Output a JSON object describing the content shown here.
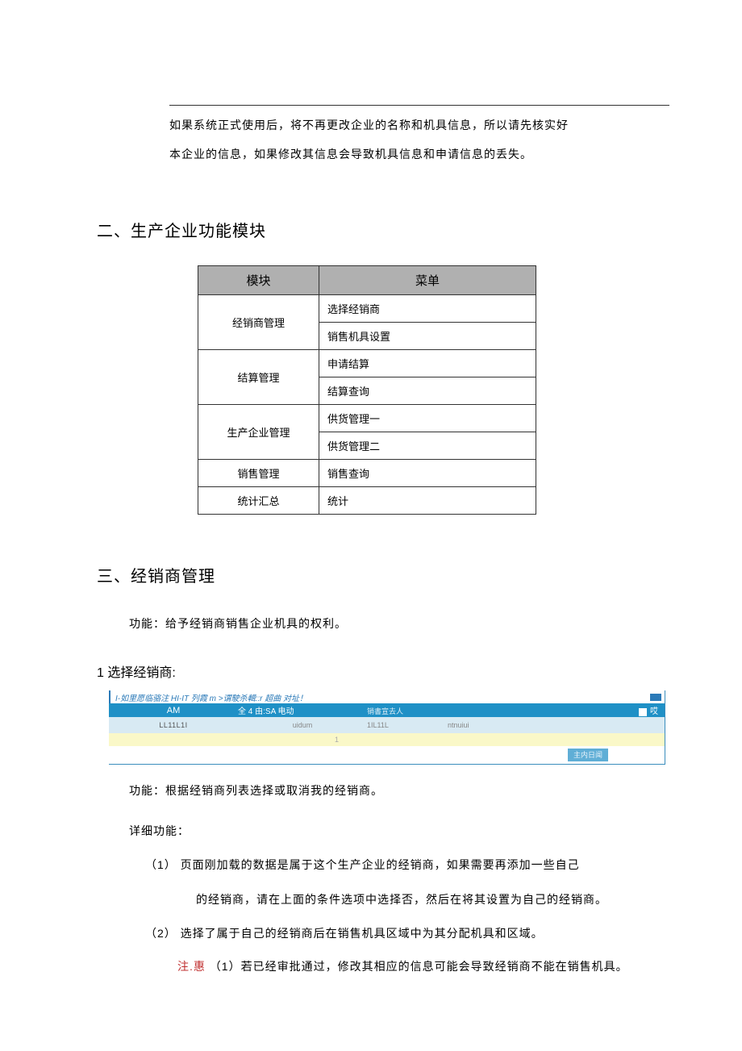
{
  "intro": {
    "line1": "如果系统正式使用后，将不再更改企业的名称和机具信息，所以请先核实好",
    "line2": "本企业的信息，如果修改其信息会导致机具信息和申请信息的丢失。"
  },
  "section2": {
    "title": "二、生产企业功能模块",
    "th_module": "模块",
    "th_menu": "菜单",
    "rows": [
      {
        "module": "经销商管理",
        "menu": "选择经销商"
      },
      {
        "module": "",
        "menu": "销售机具设置"
      },
      {
        "module": "结算管理",
        "menu": "申请结算"
      },
      {
        "module": "",
        "menu": "结算查询"
      },
      {
        "module": "生产企业管理",
        "menu": "供货管理一"
      },
      {
        "module": "",
        "menu": "供货管理二"
      },
      {
        "module": "销售管理",
        "menu": "销售查询"
      },
      {
        "module": "统计汇总",
        "menu": "统计"
      }
    ]
  },
  "section3": {
    "title": "三、经销商管理",
    "func": "功能：给予经销商销售企业机具的权利。",
    "sub1_title": "1 选择经销商:",
    "screenshot": {
      "path": "I-如里愿临骆注 HI-IT 列霞 m >谓駛杀輯::r 超曲  对址！",
      "head_c1": "AM",
      "head_c2": "全 4 由:SA 电动",
      "head_c3": "销書宣去人",
      "head_end": "哎",
      "row_c1": "LL11L1I",
      "row_c2": "uidum",
      "row_c3": "1IL11L",
      "row_c4": "ntnuiui",
      "row2": "1",
      "btn": "主内日闻"
    },
    "after_func": "功能：根据经销商列表选择或取消我的经销商。",
    "detail_label": "详细功能：",
    "item1a": "（1） 页面刚加载的数据是属于这个生产企业的经销商，如果需要再添加一些自己",
    "item1b": "的经销商，请在上面的条件选项中选择否，然后在将其设置为自己的经销商。",
    "item2": "（2） 选择了属于自己的经销商后在销售机具区域中为其分配机具和区域。",
    "note_red": "注.惠",
    "note_rest": " （1）若已经审批通过，修改其相应的信息可能会导致经销商不能在销售机具。"
  }
}
